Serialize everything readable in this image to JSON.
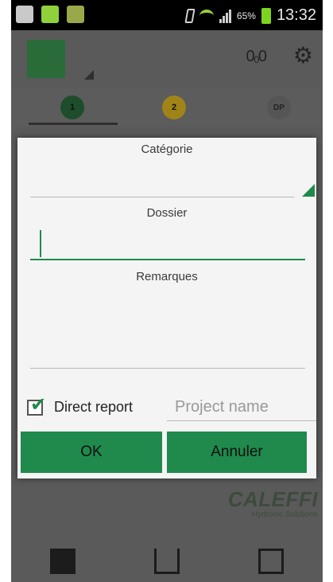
{
  "status_bar": {
    "battery": "65%",
    "time": "13:32"
  },
  "app_bar": {
    "logo_icon": "app-logo",
    "drops_icon": "0₀0",
    "settings_icon": "gear-icon"
  },
  "tabs": [
    {
      "label": "1",
      "color": "#1e4d2b"
    },
    {
      "label": "2",
      "color": "#a08418"
    },
    {
      "label": "DP",
      "color": "#555555"
    }
  ],
  "background": {
    "brand": "CALEFFI",
    "brand_sub": "Hydronic Solutions"
  },
  "dialog": {
    "categorie_label": "Catégorie",
    "dossier_label": "Dossier",
    "dossier_value": "",
    "remarques_label": "Remarques",
    "remarques_value": "",
    "direct_report_label": "Direct report",
    "direct_report_checked": true,
    "project_name_placeholder": "Project name",
    "ok_label": "OK",
    "cancel_label": "Annuler",
    "accent_color": "#1f8a4c"
  }
}
